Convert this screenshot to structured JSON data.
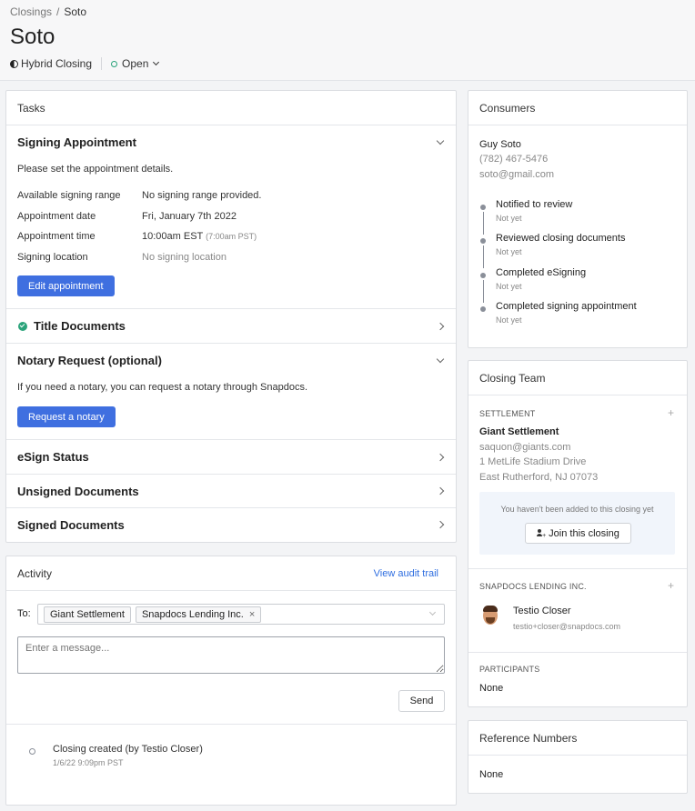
{
  "breadcrumb": {
    "parent": "Closings",
    "separator": "/",
    "current": "Soto"
  },
  "page": {
    "title": "Soto",
    "closing_type": "Hybrid Closing",
    "status": "Open"
  },
  "tasks": {
    "header": "Tasks",
    "signing": {
      "title": "Signing Appointment",
      "intro": "Please set the appointment details.",
      "range_label": "Available signing range",
      "range_value": "No signing range provided.",
      "date_label": "Appointment date",
      "date_value": "Fri, January 7th 2022",
      "time_label": "Appointment time",
      "time_value": "10:00am EST",
      "time_alt": "(7:00am PST)",
      "location_label": "Signing location",
      "location_value": "No signing location",
      "edit_button": "Edit appointment"
    },
    "title_documents": "Title Documents",
    "notary": {
      "title": "Notary Request (optional)",
      "intro": "If you need a notary, you can request a notary through Snapdocs.",
      "button": "Request a notary"
    },
    "esign_status": "eSign Status",
    "unsigned": "Unsigned Documents",
    "signed": "Signed Documents"
  },
  "activity": {
    "header": "Activity",
    "audit_link": "View audit trail",
    "to_label": "To:",
    "recipients": [
      "Giant Settlement",
      "Snapdocs Lending Inc."
    ],
    "message_placeholder": "Enter a message...",
    "send_button": "Send",
    "events": [
      {
        "text": "Closing created (by Testio Closer)",
        "time": "1/6/22 9:09pm PST"
      }
    ]
  },
  "consumers": {
    "header": "Consumers",
    "name": "Guy Soto",
    "phone": "(782) 467-5476",
    "email": "soto@gmail.com",
    "timeline": [
      {
        "label": "Notified to review",
        "status": "Not yet"
      },
      {
        "label": "Reviewed closing documents",
        "status": "Not yet"
      },
      {
        "label": "Completed eSigning",
        "status": "Not yet"
      },
      {
        "label": "Completed signing appointment",
        "status": "Not yet"
      }
    ]
  },
  "closing_team": {
    "header": "Closing Team",
    "settlement": {
      "section": "SETTLEMENT",
      "company": "Giant Settlement",
      "email": "saquon@giants.com",
      "address1": "1 MetLife Stadium Drive",
      "address2": "East Rutherford, NJ 07073",
      "notice": "You haven't been added to this closing yet",
      "join_button": "Join this closing"
    },
    "lending": {
      "section": "SNAPDOCS LENDING INC.",
      "person": "Testio Closer",
      "email": "testio+closer@snapdocs.com"
    },
    "participants": {
      "section": "PARTICIPANTS",
      "value": "None"
    }
  },
  "reference_numbers": {
    "header": "Reference Numbers",
    "value": "None"
  },
  "colors": {
    "primary": "#3f6fe0",
    "success": "#2aa37a",
    "link": "#2f6ee0"
  }
}
